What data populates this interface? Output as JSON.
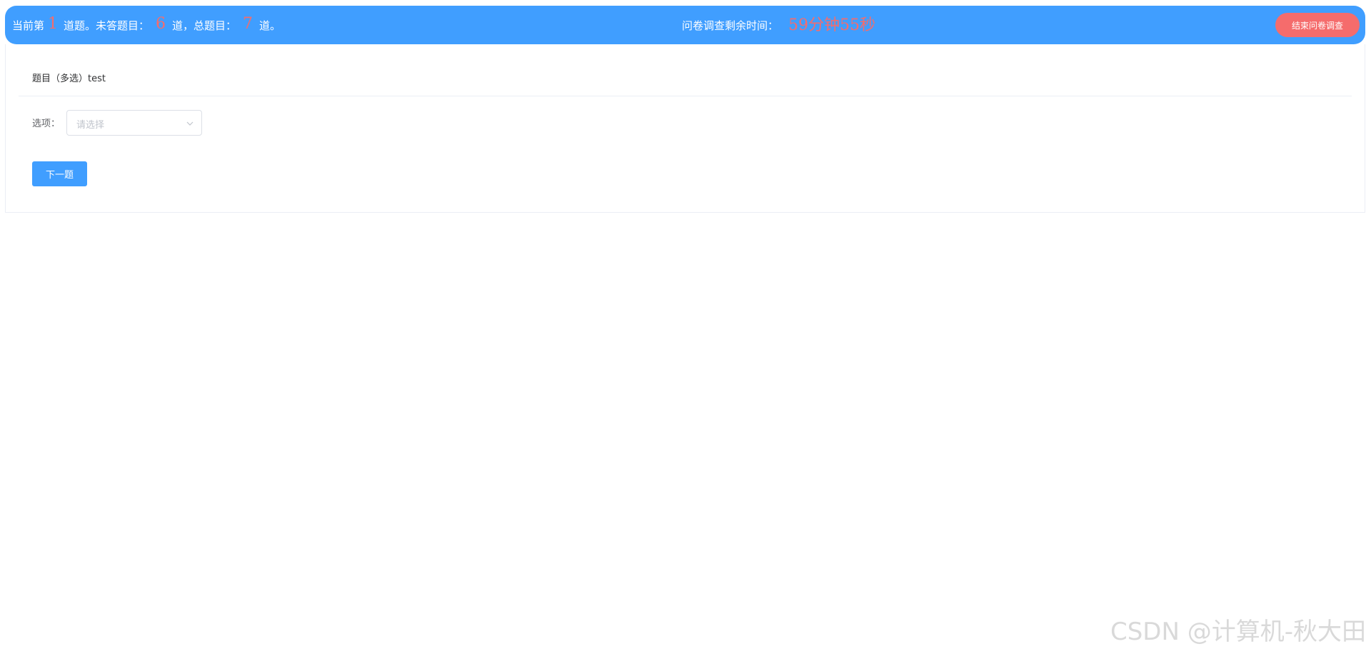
{
  "header": {
    "prefix": "当前第",
    "current": "1",
    "current_suffix": "道题。未答题目：",
    "unanswered": "6",
    "unanswered_suffix": "道，总题目：",
    "total": "7",
    "total_suffix": "道。",
    "timer_label": "问卷调查剩余时间：",
    "timer_value": "59分钟55秒",
    "end_button_label": "结束问卷调查"
  },
  "question": {
    "title": "题目（多选）test",
    "option_label": "选项：",
    "select_placeholder": "请选择",
    "next_button_label": "下一题"
  },
  "watermark": "CSDN @计算机-秋大田",
  "colors": {
    "primary": "#409eff",
    "danger": "#f56c6c"
  }
}
